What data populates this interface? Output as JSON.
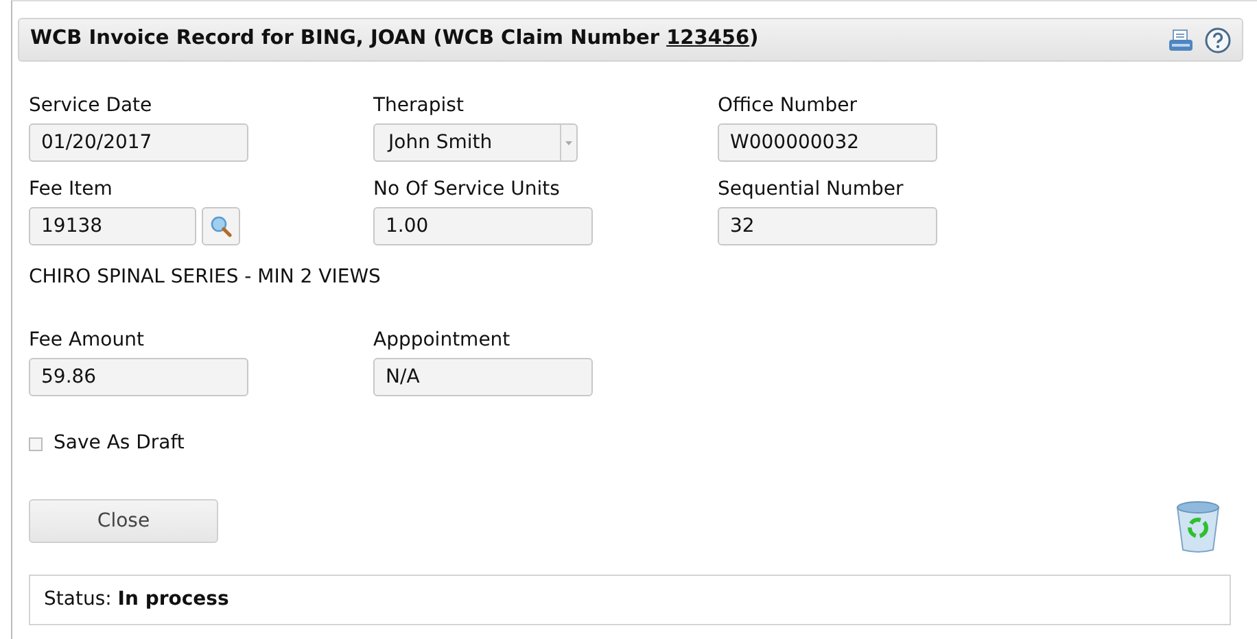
{
  "header": {
    "title_before": "WCB Invoice Record for BING, JOAN (WCB Claim Number ",
    "claim_number": "123456",
    "title_after": ")"
  },
  "field_rows": [
    [
      {
        "label": "Service Date",
        "kind": "text",
        "value": "01/20/2017"
      },
      {
        "label": "Therapist",
        "kind": "select",
        "value": "John Smith"
      },
      {
        "label": "Office Number",
        "kind": "text",
        "value": "W000000032"
      }
    ],
    [
      {
        "label": "Fee Item",
        "kind": "lookup",
        "value": "19138"
      },
      {
        "label": "No Of Service Units",
        "kind": "text",
        "value": "1.00"
      },
      {
        "label": "Sequential Number",
        "kind": "text",
        "value": "32"
      }
    ]
  ],
  "fee_description": "CHIRO SPINAL SERIES - MIN 2 VIEWS",
  "field_rows_2": [
    [
      {
        "label": "Fee Amount",
        "kind": "text",
        "value": "59.86"
      },
      {
        "label": "Apppointment",
        "kind": "text",
        "value": "N/A"
      }
    ]
  ],
  "save_as_draft": {
    "label": "Save As Draft",
    "checked": false
  },
  "close_button": "Close",
  "status": "Status: **In process**"
}
